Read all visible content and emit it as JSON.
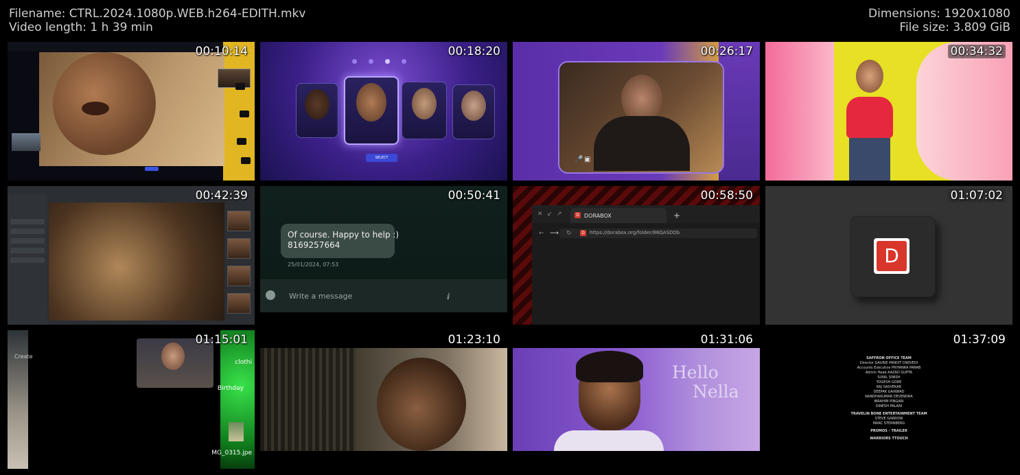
{
  "header": {
    "filename": "Filename: CTRL.2024.1080p.WEB.h264-EDITH.mkv",
    "length": "Video length: 1 h 39 min",
    "dimensions": "Dimensions: 1920x1080",
    "filesize": "File size: 3.809 GiB"
  },
  "thumbs": [
    {
      "time": "00:10:14"
    },
    {
      "time": "00:18:20"
    },
    {
      "time": "00:26:17"
    },
    {
      "time": "00:34:32"
    },
    {
      "time": "00:42:39"
    },
    {
      "time": "00:50:41"
    },
    {
      "time": "00:58:50"
    },
    {
      "time": "01:07:02"
    },
    {
      "time": "01:15:01"
    },
    {
      "time": "01:23:10"
    },
    {
      "time": "01:31:06"
    },
    {
      "time": "01:37:09"
    }
  ],
  "chat": {
    "message_line1": "Of course. Happy to help :)",
    "message_line2": "8169257664",
    "date": "25/01/2024, 07:53",
    "placeholder": "Write a message"
  },
  "browser": {
    "tab_label": "DORABOX",
    "url": "https://dorabox.org/folder/86QASDDb",
    "new_tab": "+"
  },
  "app_logo_letter": "D",
  "face_select": {
    "button": "SELECT"
  },
  "laptop": {
    "label1": "clothi",
    "label2": "Birthday",
    "label3": "MG_0315.jpe",
    "label4": "Create"
  },
  "overlay_text": {
    "hello": "Hello",
    "nella": "Nella"
  },
  "credits": [
    {
      "t": "SAFFRON OFFICE TEAM",
      "h": true
    },
    {
      "t": "Director    GAURIE PANDIT DWIVEDI"
    },
    {
      "t": "Accounts Executive    PRIYANKA PARAB"
    },
    {
      "t": "Admin Head    AAZAD GUPTA"
    },
    {
      "t": "SUNIL SINISH"
    },
    {
      "t": "YOGESH GORE"
    },
    {
      "t": "RAJ SASVEKAR"
    },
    {
      "t": "DEEPAK GAIKWAD"
    },
    {
      "t": "NANDHAKUMAR DEVENDRA"
    },
    {
      "t": "IBRAHIM PINGARI"
    },
    {
      "t": "DINESH PALANI"
    },
    {
      "t": "TRAVELIN BONE ENTERTAINMENT TEAM",
      "h": true
    },
    {
      "t": "STEVE GARROW"
    },
    {
      "t": "MARC STERNBERG"
    },
    {
      "t": "PROMOS - TRAILER",
      "h": true
    },
    {
      "t": "WARRIORS TTOUCH",
      "h": true
    }
  ]
}
